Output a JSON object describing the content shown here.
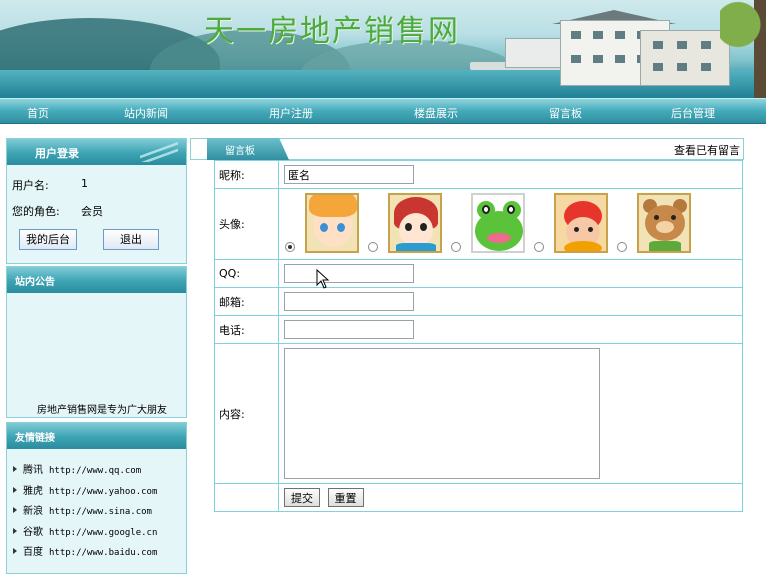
{
  "site": {
    "title": "天一房地产销售网"
  },
  "nav": {
    "items": [
      {
        "label": "首页"
      },
      {
        "label": "站内新闻"
      },
      {
        "label": "用户注册"
      },
      {
        "label": "楼盘展示"
      },
      {
        "label": "留言板"
      },
      {
        "label": "后台管理"
      }
    ]
  },
  "login": {
    "title": "用户登录",
    "username_label": "用户名:",
    "username_value": "1",
    "role_label": "您的角色:",
    "role_value": "会员",
    "backend_button": "我的后台",
    "logout_button": "退出"
  },
  "notice": {
    "title": "站内公告",
    "marquee_text": "房地产销售网是专为广大朋友"
  },
  "friend_links": {
    "title": "友情链接",
    "items": [
      {
        "name": "腾讯",
        "url": "http://www.qq.com"
      },
      {
        "name": "雅虎",
        "url": "http://www.yahoo.com"
      },
      {
        "name": "新浪",
        "url": "http://www.sina.com"
      },
      {
        "name": "谷歌",
        "url": "http://www.google.cn"
      },
      {
        "name": "百度",
        "url": "http://www.baidu.com"
      }
    ]
  },
  "guestbook": {
    "tab_label": "留言板",
    "view_link": "查看已有留言",
    "fields": {
      "nickname_label": "昵称:",
      "nickname_value": "匿名",
      "avatar_label": "头像:",
      "qq_label": "QQ:",
      "email_label": "邮箱:",
      "phone_label": "电话:",
      "content_label": "内容:"
    },
    "avatars": {
      "selected_index": 0,
      "icons": [
        "avatar-boy-icon",
        "avatar-girl-icon",
        "avatar-frog-icon",
        "avatar-bird-icon",
        "avatar-bear-icon"
      ]
    },
    "submit_button": "提交",
    "reset_button": "重置"
  }
}
